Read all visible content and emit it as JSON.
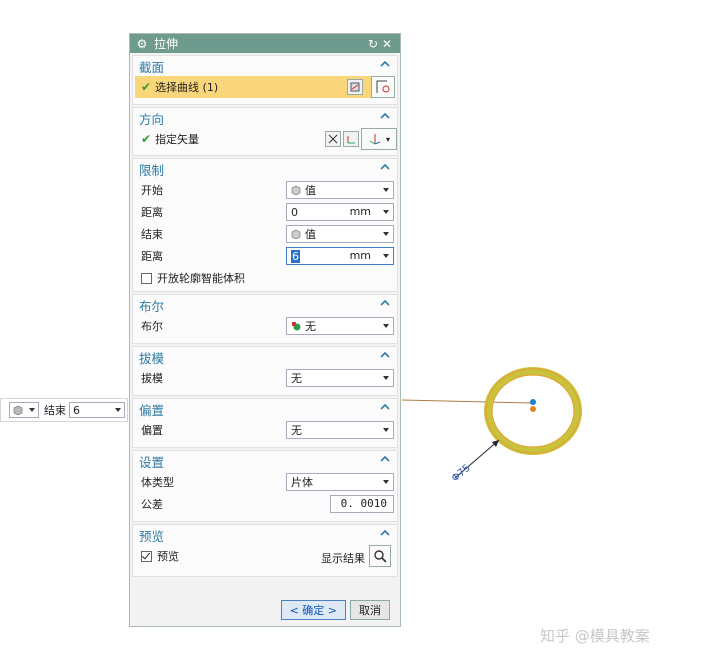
{
  "window": {
    "title": "拉伸"
  },
  "sections": {
    "section1": {
      "title": "截面",
      "select_curve": "选择曲线 (1)"
    },
    "direction": {
      "title": "方向",
      "vector": "指定矢量"
    },
    "limits": {
      "title": "限制",
      "start_label": "开始",
      "start_value": "值",
      "dist1_label": "距离",
      "dist1_value": "0",
      "dist1_unit": "mm",
      "end_label": "结束",
      "end_value": "值",
      "dist2_label": "距离",
      "dist2_value": "6",
      "dist2_unit": "mm",
      "open_profile": "开放轮廓智能体积"
    },
    "boolean": {
      "title": "布尔",
      "label": "布尔",
      "value": "无"
    },
    "draft": {
      "title": "拔模",
      "label": "拔模",
      "value": "无"
    },
    "offset": {
      "title": "偏置",
      "label": "偏置",
      "value": "无"
    },
    "settings": {
      "title": "设置",
      "body_type_label": "体类型",
      "body_type_value": "片体",
      "tolerance_label": "公差",
      "tolerance_value": "0. 0010"
    },
    "preview": {
      "title": "预览",
      "preview_label": "预览",
      "show_result": "显示结果"
    }
  },
  "buttons": {
    "ok": "< 确定 >",
    "cancel": "取消"
  },
  "floatbar": {
    "label": "结束",
    "value": "6"
  },
  "canvas": {
    "dimension": "Φ75"
  },
  "watermark": "知乎 @模具教案"
}
